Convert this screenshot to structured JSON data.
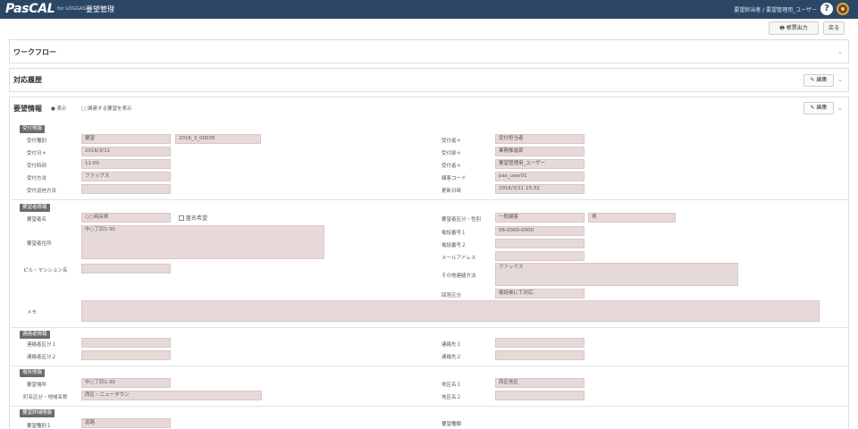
{
  "header": {
    "brand": "PasCAL",
    "brand_sub": "for LOGGAS",
    "brand_name": "要望管理",
    "user_info": "要望担当者 / 要望管理用_ユーザー",
    "help_glyph": "?"
  },
  "toolbar": {
    "print_label": "帳票出力",
    "back_label": "戻る"
  },
  "panels": {
    "workflow": {
      "title": "ワークフロー"
    },
    "history": {
      "title": "対応履歴",
      "edit_label": "✎ 編集"
    },
    "request": {
      "title": "要望情報",
      "option1": "● 表示",
      "option2": "□ 関連する要望を表示",
      "edit_label": "✎ 編集"
    }
  },
  "sections": {
    "reception": {
      "badge": "受付情報",
      "left": [
        {
          "label": "受付種別",
          "value": "要望",
          "value2": "2016_3_00035"
        },
        {
          "label": "受付日",
          "req": "＊",
          "value": "2016/3/11"
        },
        {
          "label": "受付時刻",
          "value": "11:00"
        },
        {
          "label": "受付方法",
          "value": "ファックス"
        },
        {
          "label": "受付返信方法",
          "value": ""
        }
      ],
      "right": [
        {
          "label": "受付者",
          "req": "＊",
          "value": "受付担当者"
        },
        {
          "label": "受付部",
          "req": "＊",
          "value": "業務推進部"
        },
        {
          "label": "受付者",
          "req": "＊",
          "value": "要望管理用_ユーザー"
        },
        {
          "label": "顧客コード",
          "value": "pas_user01"
        },
        {
          "label": "更新日時",
          "value": "2016/3/11 15:32"
        }
      ]
    },
    "requester": {
      "badge": "要望者情報",
      "name_label": "要望者名",
      "name_value": "○○商店様",
      "checkbox_label": "匿名希望",
      "address_label": "要望者住所",
      "address_value": "中○丁目1-30",
      "corp_label": "ピル・マンション名",
      "right": [
        {
          "label": "要望者区分・性別",
          "value": "一般顧客",
          "value2": "男"
        },
        {
          "label": "電話番号１",
          "value": "06-0000-0000"
        },
        {
          "label": "電話番号２",
          "value": ""
        },
        {
          "label": "メールアドレス",
          "value": ""
        }
      ],
      "contact_label": "その他連絡方法",
      "contact_value": "ファックス",
      "reply_label": "回答区分",
      "reply_value": "電話後にて対応",
      "memo_label": "メモ"
    },
    "contact": {
      "badge": "連絡者情報",
      "left": [
        {
          "label": "連絡者区分１",
          "value": ""
        },
        {
          "label": "連絡者区分２",
          "value": ""
        }
      ],
      "right": [
        {
          "label": "連絡先１",
          "value": ""
        },
        {
          "label": "連絡先２",
          "value": ""
        }
      ]
    },
    "location": {
      "badge": "場所情報",
      "left": [
        {
          "label": "要望場所",
          "value": "中○丁目1-30"
        },
        {
          "label": "町名区分・地域名称",
          "value": "西区・ニュータウン"
        }
      ],
      "right": [
        {
          "label": "地区名１",
          "value": "西区地区"
        },
        {
          "label": "地区名２",
          "value": ""
        }
      ]
    },
    "detail": {
      "badge": "要望詳細情報",
      "left_label": "要望種別１",
      "left_value": "道路",
      "right_label": "要望種類"
    }
  }
}
